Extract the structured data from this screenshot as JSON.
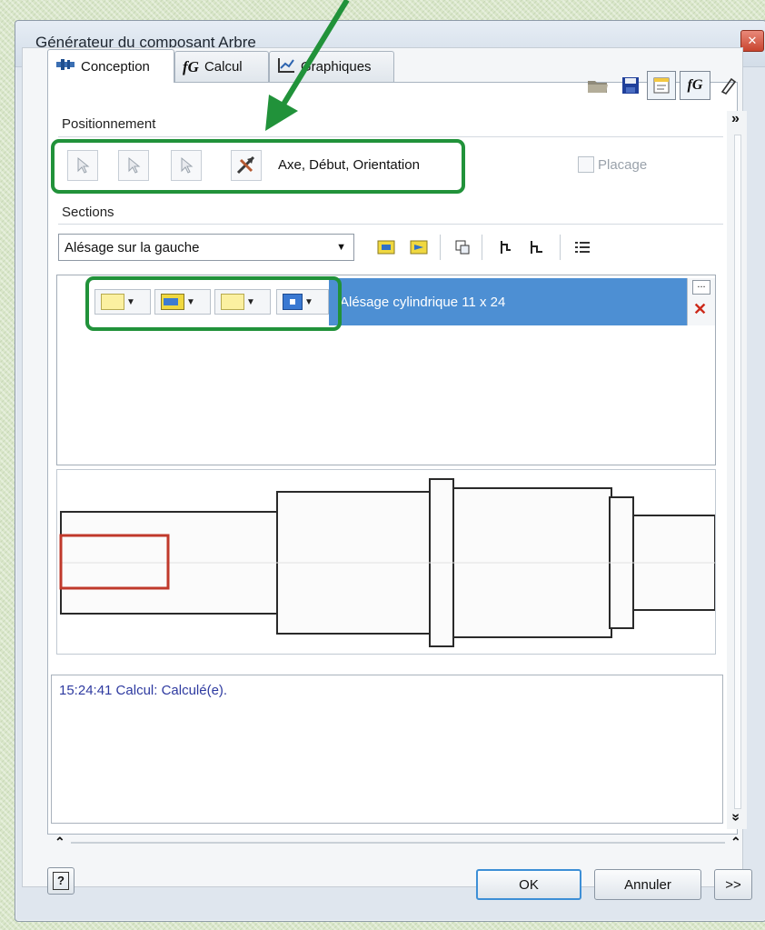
{
  "window": {
    "title": "Générateur du composant Arbre",
    "close_glyph": "✕"
  },
  "tabs": [
    {
      "label": "Conception",
      "icon": "design-icon",
      "active": true
    },
    {
      "label": "Calcul",
      "icon": "fx-icon",
      "active": false
    },
    {
      "label": "Graphiques",
      "icon": "chart-icon",
      "active": false
    }
  ],
  "toolbar_icons": [
    "open-folder-icon",
    "save-icon",
    "notes-icon",
    "fx-toggle-icon",
    "eraser-icon"
  ],
  "toolbar_glyphs": {
    "fx": "fG"
  },
  "positioning": {
    "label": "Positionnement",
    "summary": "Axe, Début, Orientation",
    "placement_checkbox": "Placage",
    "placement_checked": false
  },
  "sections": {
    "label": "Sections",
    "dropdown_value": "Alésage sur la gauche",
    "selected_row": "Alésage cylindrique 11 x 24",
    "row_more": "...",
    "row_delete": "✕"
  },
  "log": {
    "message": "15:24:41 Calcul: Calculé(e)."
  },
  "footer": {
    "help": "?",
    "ok": "OK",
    "cancel": "Annuler",
    "more": ">>"
  },
  "scroll": {
    "expand": "»",
    "collapse_up": "⌃",
    "arrow_down": "»"
  },
  "colors": {
    "highlight_green": "#21923a",
    "selection_blue": "#4d8fd3",
    "log_text": "#2e3aa0",
    "bore_outline": "#c0392b"
  }
}
